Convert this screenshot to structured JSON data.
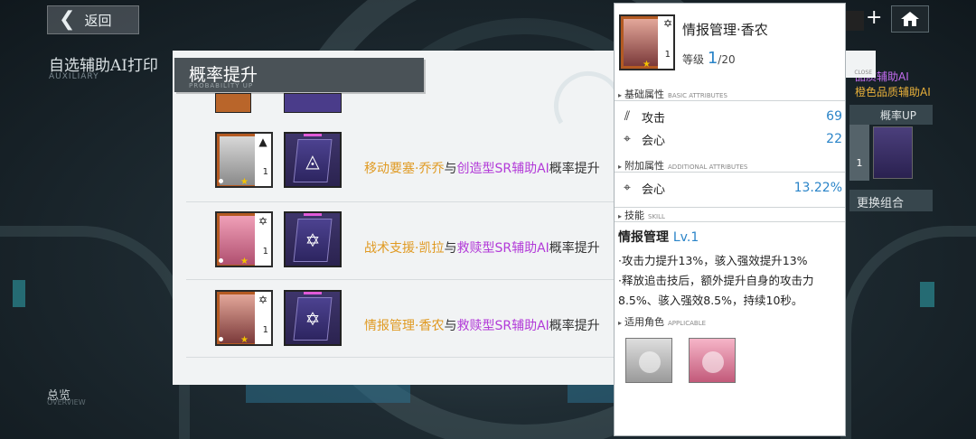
{
  "nav": {
    "back_label": "返回"
  },
  "page": {
    "title": "自选辅助AI打印",
    "subtitle": "AUXILIARY",
    "total_label": "总览"
  },
  "right_panel": {
    "label_1": "品质辅助AI",
    "label_2": "橙色品质辅助AI",
    "rate_up_label": "概率UP",
    "count": "1",
    "change_label": "更换组合"
  },
  "modal": {
    "title": "概率提升",
    "subtitle": "PROBABILITY UP",
    "close_label": "CLOSE",
    "rows": [
      {
        "char_name": "移动要塞·乔乔",
        "connector": "与",
        "ai_name": "创造型SR辅助AI",
        "suffix": "概率提升",
        "level": "1",
        "badge_icon": "triangle-icon",
        "card_icon": "triangle-icon"
      },
      {
        "char_name": "战术支援·凯拉",
        "connector": "与",
        "ai_name": "救赎型SR辅助AI",
        "suffix": "概率提升",
        "level": "1",
        "badge_icon": "star-icon",
        "card_icon": "star-icon"
      },
      {
        "char_name": "情报管理·香农",
        "connector": "与",
        "ai_name": "救赎型SR辅助AI",
        "suffix": "概率提升",
        "level": "1",
        "badge_icon": "star-icon",
        "card_icon": "star-icon"
      }
    ]
  },
  "detail": {
    "name": "情报管理·香农",
    "level_label": "等级",
    "level_current": "1",
    "level_max": "/20",
    "avatar_level": "1",
    "basic_title": "基础属性",
    "basic_title_en": "BASIC ATTRIBUTES",
    "basic_attrs": [
      {
        "icon": "attack-icon",
        "label": "攻击",
        "value": "69"
      },
      {
        "icon": "crit-icon",
        "label": "会心",
        "value": "22"
      }
    ],
    "extra_title": "附加属性",
    "extra_title_en": "ADDITIONAL ATTRIBUTES",
    "extra_attrs": [
      {
        "icon": "crit-icon",
        "label": "会心",
        "value": "13.22%"
      }
    ],
    "skill_title": "技能",
    "skill_title_en": "SKILL",
    "skill_name": "情报管理",
    "skill_level": "Lv.1",
    "skill_desc_1": "·攻击力提升13%，骇入强效提升13%",
    "skill_desc_2": "·释放追击技后，额外提升自身的攻击力8.5%、骇入强效8.5%，持续10秒。",
    "applicable_title": "适用角色",
    "applicable_title_en": "APPLICABLE"
  },
  "colors": {
    "orange": "#e09a22",
    "purple": "#b23ad8",
    "blue": "#2a84c8",
    "panel_header": "#4a5257"
  }
}
